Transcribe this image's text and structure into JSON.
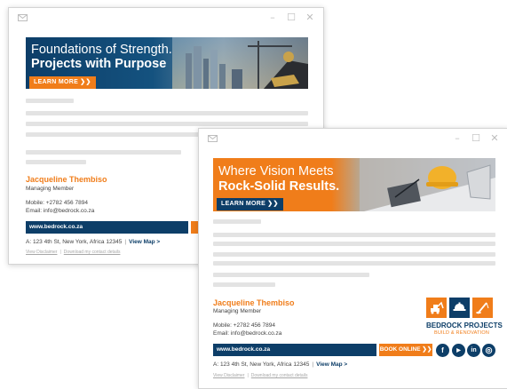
{
  "colors": {
    "navy": "#0d3e68",
    "orange": "#f07d1a",
    "skeleton": "#e3e3e3"
  },
  "window_controls": {
    "minimize": "–",
    "maximize": "☐",
    "close": "✕"
  },
  "signature_back": {
    "banner": {
      "line1": "Foundations of Strength.",
      "line2": "Projects with Purpose",
      "button": "LEARN MORE ❯❯"
    },
    "name": "Jacqueline Thembiso",
    "role": "Managing Member",
    "mobile": "Mobile: +2782 456 7894",
    "email": "Email: info@bedrock.co.za",
    "website": "www.bedrock.co.za",
    "address": "A: 123 4th St, New York, Africa 12345",
    "separator": "|",
    "map_link": "View Map >",
    "disclaimer": "View Disclaimer",
    "download": "Download my contact details"
  },
  "signature_front": {
    "banner": {
      "line1": "Where Vision Meets",
      "line2": "Rock-Solid Results.",
      "button": "LEARN MORE ❯❯"
    },
    "name": "Jacqueline Thembiso",
    "role": "Managing Member",
    "mobile": "Mobile: +2782 456 7894",
    "email": "Email: info@bedrock.co.za",
    "website": "www.bedrock.co.za",
    "book_button": "BOOK ONLINE ❯❯",
    "brand": "BEDROCK PROJECTS",
    "brand_sub": "BUILD & RENOVATION",
    "social": {
      "facebook": "f",
      "youtube": "▶",
      "linkedin": "in",
      "instagram": "◎"
    },
    "address": "A: 123 4th St, New York, Africa 12345",
    "separator": "|",
    "map_link": "View Map >",
    "disclaimer": "View Disclaimer",
    "download": "Download my contact details"
  }
}
